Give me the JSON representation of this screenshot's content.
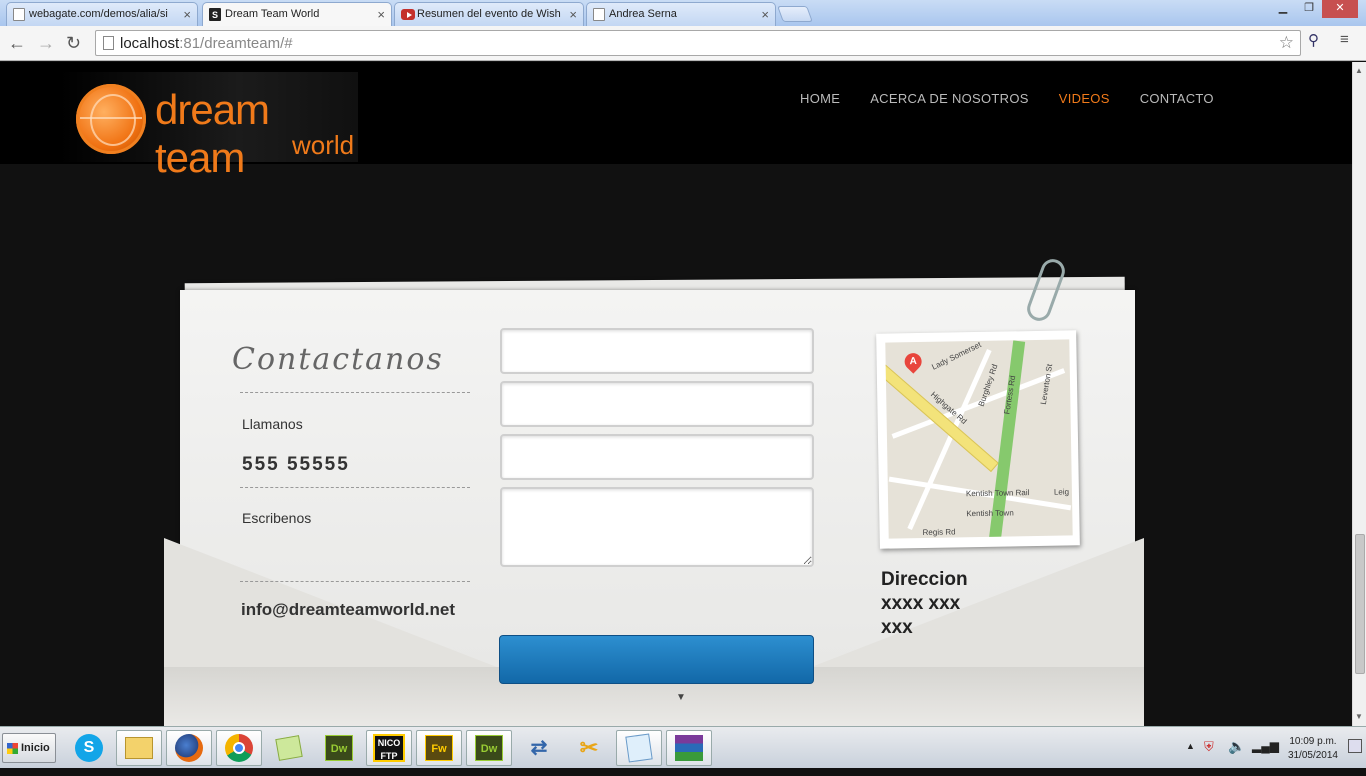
{
  "browser": {
    "tabs": [
      {
        "title": "webagate.com/demos/alia/si",
        "icon": "page-icon",
        "active": false
      },
      {
        "title": "Dream Team World",
        "icon": "site-s-icon",
        "active": true
      },
      {
        "title": "Resumen del evento de Wish",
        "icon": "youtube-icon",
        "active": false
      },
      {
        "title": "Andrea Serna",
        "icon": "page-icon",
        "active": false
      }
    ],
    "close_glyph": "×",
    "url_host": "localhost",
    "url_rest": ":81/dreamteam/#"
  },
  "site": {
    "logo_main": "dream team",
    "logo_sub": "world",
    "nav": [
      {
        "label": "HOME",
        "active": false
      },
      {
        "label": "ACERCA DE NOSOTROS",
        "active": false
      },
      {
        "label": "VIDEOS",
        "active": true
      },
      {
        "label": "CONTACTO",
        "active": false
      }
    ],
    "accent_color": "#f07a1a"
  },
  "contact": {
    "title": "Contactanos",
    "call_label": "Llamanos",
    "phone": "555 55555",
    "write_label": "Escribenos",
    "email": "info@dreamteamworld.net",
    "fields": [
      {
        "value": "",
        "placeholder": ""
      },
      {
        "value": "",
        "placeholder": ""
      },
      {
        "value": "",
        "placeholder": ""
      },
      {
        "value": "",
        "placeholder": ""
      }
    ],
    "submit_color": "#1a78bf"
  },
  "map": {
    "pin_label": "A",
    "streets": [
      "Lady Somerset",
      "Burghley Rd",
      "Fortess Rd",
      "Leverton St",
      "Highgate Rd",
      "Kentish Town Rail",
      "Kentish Town",
      "Leig",
      "Regis Rd"
    ]
  },
  "address": {
    "title": "Direccion",
    "line1": "xxxx xxx",
    "line2": "xxx"
  },
  "taskbar": {
    "start_label": "Inicio",
    "apps": [
      "skype-icon",
      "explorer-icon",
      "firefox-icon",
      "chrome-icon",
      "notes-icon",
      "dreamweaver-icon",
      "nicoftp-icon",
      "fireworks-icon",
      "dreamweaver-icon",
      "network-icon",
      "tools-icon",
      "notepad-icon",
      "winrar-icon"
    ],
    "app_labels": {
      "dw": "Dw",
      "fw": "Fw",
      "nico": "NICO FTP"
    },
    "time": "10:09 p.m.",
    "date": "31/05/2014"
  }
}
